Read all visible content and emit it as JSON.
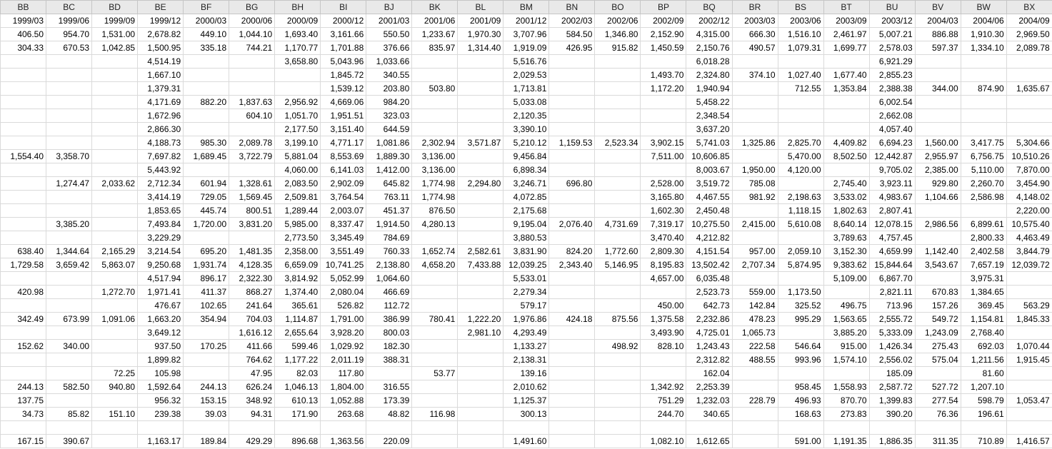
{
  "sheet": {
    "columns": [
      "BB",
      "BC",
      "BD",
      "BE",
      "BF",
      "BG",
      "BH",
      "BI",
      "BJ",
      "BK",
      "BL",
      "BM",
      "BN",
      "BO",
      "BP",
      "BQ",
      "BR",
      "BS",
      "BT",
      "BU",
      "BV",
      "BW",
      "BX"
    ],
    "rows": [
      [
        "1999/03",
        "1999/06",
        "1999/09",
        "1999/12",
        "2000/03",
        "2000/06",
        "2000/09",
        "2000/12",
        "2001/03",
        "2001/06",
        "2001/09",
        "2001/12",
        "2002/03",
        "2002/06",
        "2002/09",
        "2002/12",
        "2003/03",
        "2003/06",
        "2003/09",
        "2003/12",
        "2004/03",
        "2004/06",
        "2004/09"
      ],
      [
        "406.50",
        "954.70",
        "1,531.00",
        "2,678.82",
        "449.10",
        "1,044.10",
        "1,693.40",
        "3,161.66",
        "550.50",
        "1,233.67",
        "1,970.30",
        "3,707.96",
        "584.50",
        "1,346.80",
        "2,152.90",
        "4,315.00",
        "666.30",
        "1,516.10",
        "2,461.97",
        "5,007.21",
        "886.88",
        "1,910.30",
        "2,969.50"
      ],
      [
        "304.33",
        "670.53",
        "1,042.85",
        "1,500.95",
        "335.18",
        "744.21",
        "1,170.77",
        "1,701.88",
        "376.66",
        "835.97",
        "1,314.40",
        "1,919.09",
        "426.95",
        "915.82",
        "1,450.59",
        "2,150.76",
        "490.57",
        "1,079.31",
        "1,699.77",
        "2,578.03",
        "597.37",
        "1,334.10",
        "2,089.78"
      ],
      [
        "",
        "",
        "",
        "4,514.19",
        "",
        "",
        "3,658.80",
        "5,043.96",
        "1,033.66",
        "",
        "",
        "5,516.76",
        "",
        "",
        "",
        "6,018.28",
        "",
        "",
        "",
        "6,921.29",
        "",
        "",
        ""
      ],
      [
        "",
        "",
        "",
        "1,667.10",
        "",
        "",
        "",
        "1,845.72",
        "340.55",
        "",
        "",
        "2,029.53",
        "",
        "",
        "1,493.70",
        "2,324.80",
        "374.10",
        "1,027.40",
        "1,677.40",
        "2,855.23",
        "",
        "",
        ""
      ],
      [
        "",
        "",
        "",
        "1,379.31",
        "",
        "",
        "",
        "1,539.12",
        "203.80",
        "503.80",
        "",
        "1,713.81",
        "",
        "",
        "1,172.20",
        "1,940.94",
        "",
        "712.55",
        "1,353.84",
        "2,388.38",
        "344.00",
        "874.90",
        "1,635.67"
      ],
      [
        "",
        "",
        "",
        "4,171.69",
        "882.20",
        "1,837.63",
        "2,956.92",
        "4,669.06",
        "984.20",
        "",
        "",
        "5,033.08",
        "",
        "",
        "",
        "5,458.22",
        "",
        "",
        "",
        "6,002.54",
        "",
        "",
        ""
      ],
      [
        "",
        "",
        "",
        "1,672.96",
        "",
        "604.10",
        "1,051.70",
        "1,951.51",
        "323.03",
        "",
        "",
        "2,120.35",
        "",
        "",
        "",
        "2,348.54",
        "",
        "",
        "",
        "2,662.08",
        "",
        "",
        ""
      ],
      [
        "",
        "",
        "",
        "2,866.30",
        "",
        "",
        "2,177.50",
        "3,151.40",
        "644.59",
        "",
        "",
        "3,390.10",
        "",
        "",
        "",
        "3,637.20",
        "",
        "",
        "",
        "4,057.40",
        "",
        "",
        ""
      ],
      [
        "",
        "",
        "",
        "4,188.73",
        "985.30",
        "2,089.78",
        "3,199.10",
        "4,771.17",
        "1,081.86",
        "2,302.94",
        "3,571.87",
        "5,210.12",
        "1,159.53",
        "2,523.34",
        "3,902.15",
        "5,741.03",
        "1,325.86",
        "2,825.70",
        "4,409.82",
        "6,694.23",
        "1,560.00",
        "3,417.75",
        "5,304.66"
      ],
      [
        "1,554.40",
        "3,358.70",
        "",
        "7,697.82",
        "1,689.45",
        "3,722.79",
        "5,881.04",
        "8,553.69",
        "1,889.30",
        "3,136.00",
        "",
        "9,456.84",
        "",
        "",
        "7,511.00",
        "10,606.85",
        "",
        "5,470.00",
        "8,502.50",
        "12,442.87",
        "2,955.97",
        "6,756.75",
        "10,510.26"
      ],
      [
        "",
        "",
        "",
        "5,443.92",
        "",
        "",
        "4,060.00",
        "6,141.03",
        "1,412.00",
        "3,136.00",
        "",
        "6,898.34",
        "",
        "",
        "",
        "8,003.67",
        "1,950.00",
        "4,120.00",
        "",
        "9,705.02",
        "2,385.00",
        "5,110.00",
        "7,870.00"
      ],
      [
        "",
        "1,274.47",
        "2,033.62",
        "2,712.34",
        "601.94",
        "1,328.61",
        "2,083.50",
        "2,902.09",
        "645.82",
        "1,774.98",
        "2,294.80",
        "3,246.71",
        "696.80",
        "",
        "2,528.00",
        "3,519.72",
        "785.08",
        "",
        "2,745.40",
        "3,923.11",
        "929.80",
        "2,260.70",
        "3,454.90"
      ],
      [
        "",
        "",
        "",
        "3,414.19",
        "729.05",
        "1,569.45",
        "2,509.81",
        "3,764.54",
        "763.11",
        "1,774.98",
        "",
        "4,072.85",
        "",
        "",
        "3,165.80",
        "4,467.55",
        "981.92",
        "2,198.63",
        "3,533.02",
        "4,983.67",
        "1,104.66",
        "2,586.98",
        "4,148.02"
      ],
      [
        "",
        "",
        "",
        "1,853.65",
        "445.74",
        "800.51",
        "1,289.44",
        "2,003.07",
        "451.37",
        "876.50",
        "",
        "2,175.68",
        "",
        "",
        "1,602.30",
        "2,450.48",
        "",
        "1,118.15",
        "1,802.63",
        "2,807.41",
        "",
        "",
        "2,220.00"
      ],
      [
        "",
        "3,385.20",
        "",
        "7,493.84",
        "1,720.00",
        "3,831.20",
        "5,985.00",
        "8,337.47",
        "1,914.50",
        "4,280.13",
        "",
        "9,195.04",
        "2,076.40",
        "4,731.69",
        "7,319.17",
        "10,275.50",
        "2,415.00",
        "5,610.08",
        "8,640.14",
        "12,078.15",
        "2,986.56",
        "6,899.61",
        "10,575.40"
      ],
      [
        "",
        "",
        "",
        "3,229.29",
        "",
        "",
        "2,773.50",
        "3,345.49",
        "784.69",
        "",
        "",
        "3,880.53",
        "",
        "",
        "3,470.40",
        "4,212.82",
        "",
        "",
        "3,789.63",
        "4,757.45",
        "",
        "2,800.33",
        "4,463.49"
      ],
      [
        "638.40",
        "1,344.64",
        "2,165.29",
        "3,214.54",
        "695.20",
        "1,481.35",
        "2,358.00",
        "3,551.49",
        "760.33",
        "1,652.74",
        "2,582.61",
        "3,831.90",
        "824.20",
        "1,772.60",
        "2,809.30",
        "4,151.54",
        "957.00",
        "2,059.10",
        "3,152.30",
        "4,659.99",
        "1,142.40",
        "2,402.58",
        "3,844.79"
      ],
      [
        "1,729.58",
        "3,659.42",
        "5,863.07",
        "9,250.68",
        "1,931.74",
        "4,128.35",
        "6,659.09",
        "10,741.25",
        "2,138.80",
        "4,658.20",
        "7,433.88",
        "12,039.25",
        "2,343.40",
        "5,146.95",
        "8,195.83",
        "13,502.42",
        "2,707.34",
        "5,874.95",
        "9,383.62",
        "15,844.64",
        "3,543.67",
        "7,657.19",
        "12,039.72"
      ],
      [
        "",
        "",
        "",
        "4,517.94",
        "896.17",
        "2,322.30",
        "3,814.92",
        "5,052.99",
        "1,064.60",
        "",
        "",
        "5,533.01",
        "",
        "",
        "4,657.00",
        "6,035.48",
        "",
        "",
        "5,109.00",
        "6,867.70",
        "",
        "3,975.31",
        ""
      ],
      [
        "420.98",
        "",
        "1,272.70",
        "1,971.41",
        "411.37",
        "868.27",
        "1,374.40",
        "2,080.04",
        "466.69",
        "",
        "",
        "2,279.34",
        "",
        "",
        "",
        "2,523.73",
        "559.00",
        "1,173.50",
        "",
        "2,821.11",
        "670.83",
        "1,384.65",
        ""
      ],
      [
        "",
        "",
        "",
        "476.67",
        "102.65",
        "241.64",
        "365.61",
        "526.82",
        "112.72",
        "",
        "",
        "579.17",
        "",
        "",
        "450.00",
        "642.73",
        "142.84",
        "325.52",
        "496.75",
        "713.96",
        "157.26",
        "369.45",
        "563.29"
      ],
      [
        "342.49",
        "673.99",
        "1,091.06",
        "1,663.20",
        "354.94",
        "704.03",
        "1,114.87",
        "1,791.00",
        "386.99",
        "780.41",
        "1,222.20",
        "1,976.86",
        "424.18",
        "875.56",
        "1,375.58",
        "2,232.86",
        "478.23",
        "995.29",
        "1,563.65",
        "2,555.72",
        "549.72",
        "1,154.81",
        "1,845.33"
      ],
      [
        "",
        "",
        "",
        "3,649.12",
        "",
        "1,616.12",
        "2,655.64",
        "3,928.20",
        "800.03",
        "",
        "2,981.10",
        "4,293.49",
        "",
        "",
        "3,493.90",
        "4,725.01",
        "1,065.73",
        "",
        "3,885.20",
        "5,333.09",
        "1,243.09",
        "2,768.40",
        ""
      ],
      [
        "152.62",
        "340.00",
        "",
        "937.50",
        "170.25",
        "411.66",
        "599.46",
        "1,029.92",
        "182.30",
        "",
        "",
        "1,133.27",
        "",
        "498.92",
        "828.10",
        "1,243.43",
        "222.58",
        "546.64",
        "915.00",
        "1,426.34",
        "275.43",
        "692.03",
        "1,070.44"
      ],
      [
        "",
        "",
        "",
        "1,899.82",
        "",
        "764.62",
        "1,177.22",
        "2,011.19",
        "388.31",
        "",
        "",
        "2,138.31",
        "",
        "",
        "",
        "2,312.82",
        "488.55",
        "993.96",
        "1,574.10",
        "2,556.02",
        "575.04",
        "1,211.56",
        "1,915.45"
      ],
      [
        "",
        "",
        "72.25",
        "105.98",
        "",
        "47.95",
        "82.03",
        "117.80",
        "",
        "53.77",
        "",
        "139.16",
        "",
        "",
        "",
        "162.04",
        "",
        "",
        "",
        "185.09",
        "",
        "81.60",
        ""
      ],
      [
        "244.13",
        "582.50",
        "940.80",
        "1,592.64",
        "244.13",
        "626.24",
        "1,046.13",
        "1,804.00",
        "316.55",
        "",
        "",
        "2,010.62",
        "",
        "",
        "1,342.92",
        "2,253.39",
        "",
        "958.45",
        "1,558.93",
        "2,587.72",
        "527.72",
        "1,207.10",
        ""
      ],
      [
        "137.75",
        "",
        "",
        "956.32",
        "153.15",
        "348.92",
        "610.13",
        "1,052.88",
        "173.39",
        "",
        "",
        "1,125.37",
        "",
        "",
        "751.29",
        "1,232.03",
        "228.79",
        "496.93",
        "870.70",
        "1,399.83",
        "277.54",
        "598.79",
        "1,053.47"
      ],
      [
        "34.73",
        "85.82",
        "151.10",
        "239.38",
        "39.03",
        "94.31",
        "171.90",
        "263.68",
        "48.82",
        "116.98",
        "",
        "300.13",
        "",
        "",
        "244.70",
        "340.65",
        "",
        "168.63",
        "273.83",
        "390.20",
        "76.36",
        "196.61",
        ""
      ],
      [
        "",
        "",
        "",
        "",
        "",
        "",
        "",
        "",
        "",
        "",
        "",
        "",
        "",
        "",
        "",
        "",
        "",
        "",
        "",
        "",
        "",
        "",
        ""
      ],
      [
        "167.15",
        "390.67",
        "",
        "1,163.17",
        "189.84",
        "429.29",
        "896.68",
        "1,363.56",
        "220.09",
        "",
        "",
        "1,491.60",
        "",
        "",
        "1,082.10",
        "1,612.65",
        "",
        "591.00",
        "1,191.35",
        "1,886.35",
        "311.35",
        "710.89",
        "1,416.57"
      ]
    ]
  }
}
